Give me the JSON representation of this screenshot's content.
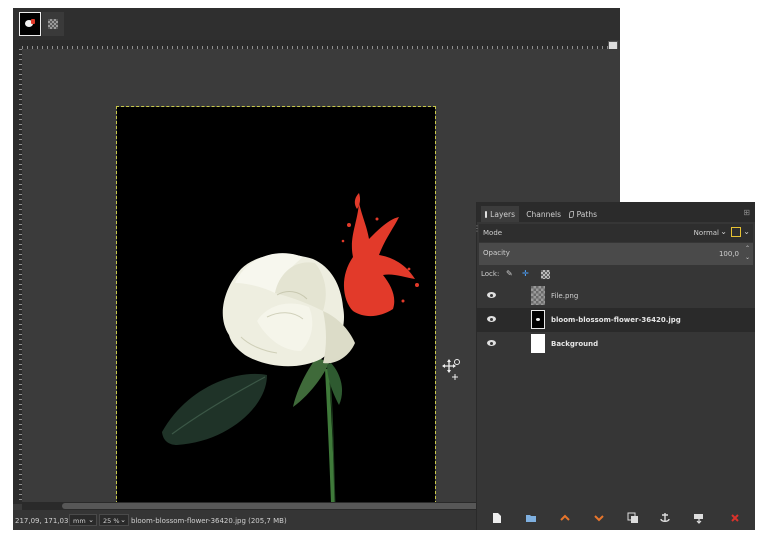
{
  "statusbar": {
    "coords": "217,09, 171,03",
    "unit": "mm",
    "zoom": "25 %",
    "file_info": "bloom-blossom-flower-36420.jpg (205,7 MB)"
  },
  "dock": {
    "tabs": [
      {
        "label": "Layers",
        "icon": "layers-icon"
      },
      {
        "label": "Channels",
        "icon": "channels-icon"
      },
      {
        "label": "Paths",
        "icon": "paths-icon"
      }
    ],
    "mode_label": "Mode",
    "mode_value": "Normal",
    "opacity_label": "Opacity",
    "opacity_value": "100,0",
    "lock_label": "Lock:",
    "layers": [
      {
        "name": "File.png",
        "visible": true,
        "selected": false,
        "thumb": "checker"
      },
      {
        "name": "bloom-blossom-flower-36420.jpg",
        "visible": true,
        "selected": true,
        "thumb": "image"
      },
      {
        "name": "Background",
        "visible": true,
        "selected": false,
        "thumb": "white"
      }
    ],
    "bottom_buttons": [
      "new-layer-icon",
      "new-layer-group-icon",
      "raise-layer-icon",
      "lower-layer-icon",
      "duplicate-layer-icon",
      "anchor-layer-icon",
      "merge-down-icon",
      "delete-layer-icon"
    ]
  },
  "colors": {
    "canvas_bg": "#000000",
    "workspace_bg": "#3b3b3b",
    "panel_bg": "#363636",
    "splash_red": "#e23a2a",
    "rose_white": "#f2f2ea",
    "arrow_orange": "#e8762c",
    "delete_red": "#d9322b",
    "mode_switch_yellow": "#e7c233"
  }
}
